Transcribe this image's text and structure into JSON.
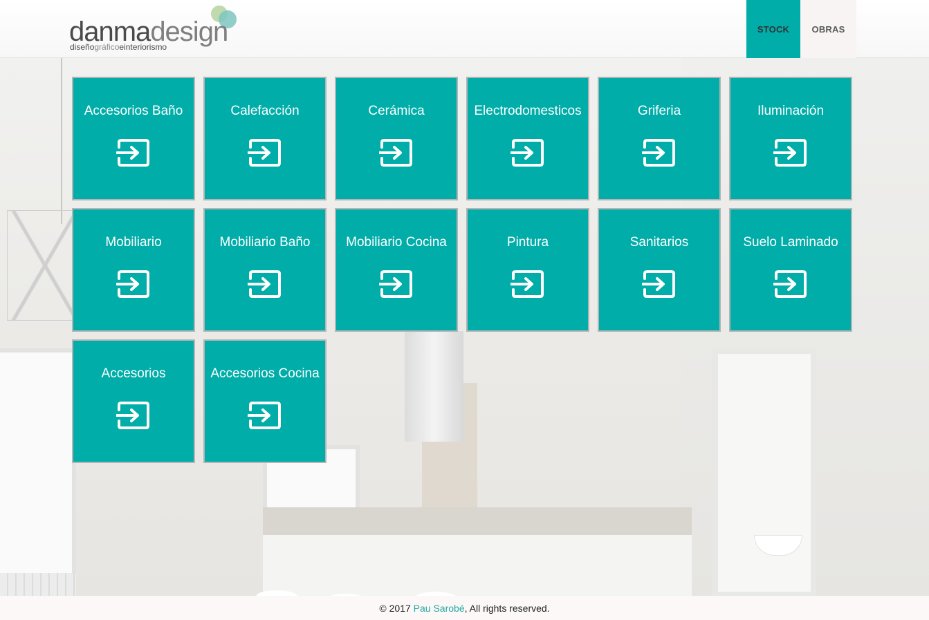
{
  "brand": {
    "word_part1": "danma",
    "word_part2": "design",
    "tagline_part1": "diseño",
    "tagline_part2": "gráfico",
    "tagline_part3": "e",
    "tagline_part4": "interiorismo"
  },
  "nav": {
    "items": [
      {
        "label": "STOCK",
        "active": true
      },
      {
        "label": "OBRAS",
        "active": false
      }
    ]
  },
  "tiles": [
    {
      "label": "Accesorios Baño",
      "icon": "enter-icon"
    },
    {
      "label": "Calefacción",
      "icon": "enter-icon"
    },
    {
      "label": "Cerámica",
      "icon": "enter-icon"
    },
    {
      "label": "Electrodomesticos",
      "icon": "enter-icon"
    },
    {
      "label": "Griferia",
      "icon": "enter-icon"
    },
    {
      "label": "Iluminación",
      "icon": "enter-icon"
    },
    {
      "label": "Mobiliario",
      "icon": "enter-icon"
    },
    {
      "label": "Mobiliario Baño",
      "icon": "enter-icon"
    },
    {
      "label": "Mobiliario Cocina",
      "icon": "enter-icon"
    },
    {
      "label": "Pintura",
      "icon": "enter-icon"
    },
    {
      "label": "Sanitarios",
      "icon": "enter-icon"
    },
    {
      "label": "Suelo Laminado",
      "icon": "enter-icon"
    },
    {
      "label": "Accesorios",
      "icon": "enter-icon"
    },
    {
      "label": "Accesorios Cocina",
      "icon": "enter-icon"
    }
  ],
  "footer": {
    "prefix": "© 2017 ",
    "author": "Pau Sarobé",
    "suffix": ", All rights reserved."
  },
  "colors": {
    "accent": "#00ada9",
    "tile_text": "#ffffff",
    "link": "#26a7a3"
  }
}
